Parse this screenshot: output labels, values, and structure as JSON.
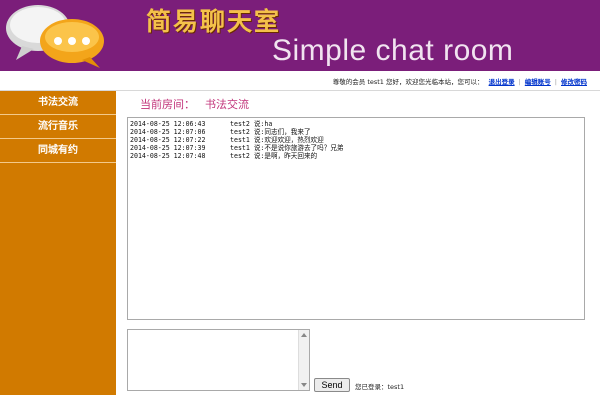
{
  "banner": {
    "title_cn": "简易聊天室",
    "title_en": "Simple chat room",
    "logo_icon": "chat-bubbles-icon"
  },
  "userbar": {
    "greeting": "尊敬的会员 test1 您好，欢迎您光临本站，您可以：",
    "logout_label": "退出登录",
    "edit_account_label": "编辑账号",
    "change_password_label": "修改密码"
  },
  "sidebar": {
    "items": [
      {
        "label": "书法交流"
      },
      {
        "label": "流行音乐"
      },
      {
        "label": "同城有约"
      }
    ]
  },
  "room": {
    "label": "当前房间：",
    "name": "书法交流"
  },
  "chat": {
    "messages": [
      {
        "time": "2014-08-25 12:06:43",
        "text": "test2 说:ha"
      },
      {
        "time": "2014-08-25 12:07:06",
        "text": "test2 说:同志们，我来了"
      },
      {
        "time": "2014-08-25 12:07:22",
        "text": "test1 说:欢迎欢迎，热烈欢迎"
      },
      {
        "time": "2014-08-25 12:07:39",
        "text": "test1 说:不是说你旅游去了吗？兄弟"
      },
      {
        "time": "2014-08-25 12:07:48",
        "text": "test2 说:是啊，昨天回来的"
      }
    ]
  },
  "composer": {
    "send_label": "Send",
    "login_status": "您已登录：test1"
  },
  "colors": {
    "banner": "#7b1e7a",
    "sidebar": "#d17a00",
    "room_title": "#c2337a",
    "link": "#0033cc"
  }
}
